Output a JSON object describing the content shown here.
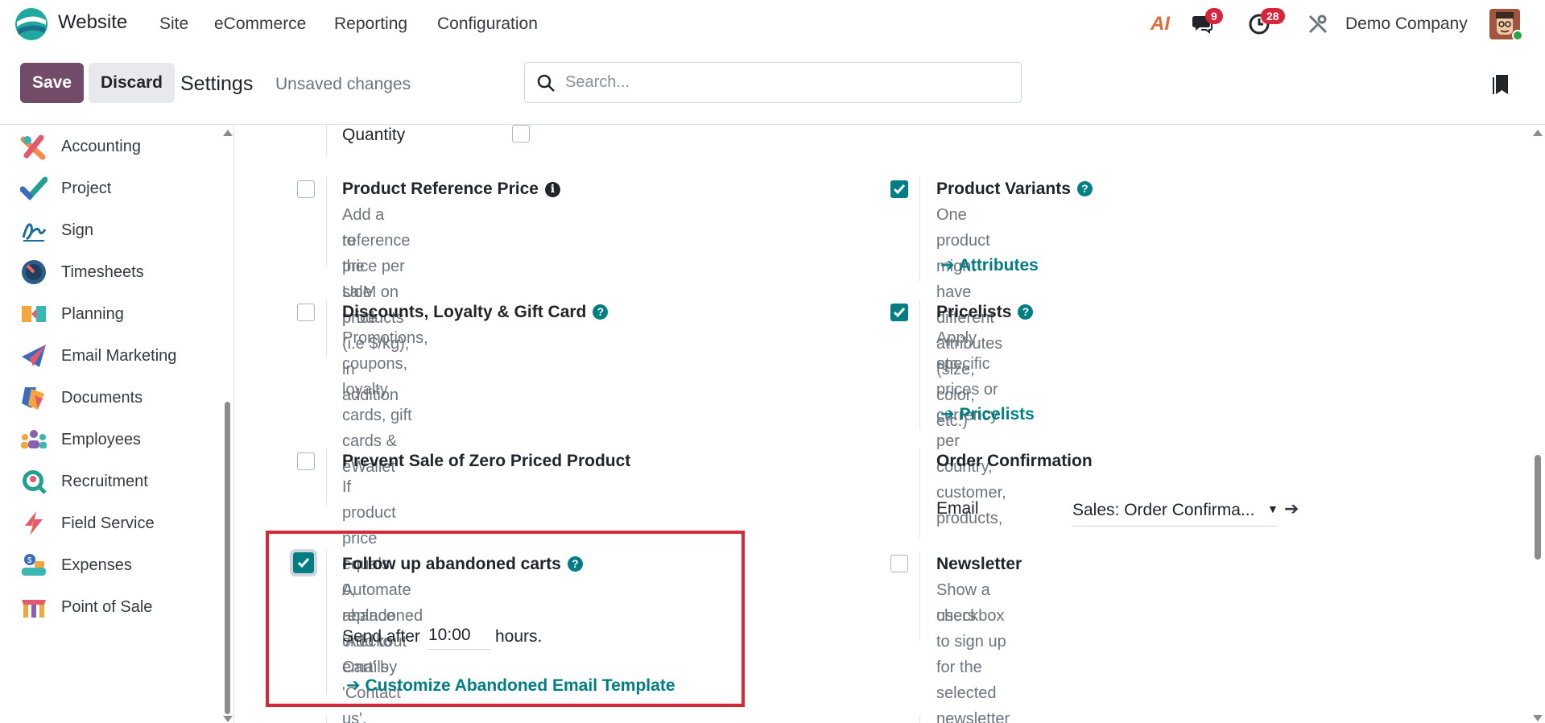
{
  "topnav": {
    "app_title": "Website",
    "menu": [
      "Site",
      "eCommerce",
      "Reporting",
      "Configuration"
    ],
    "messages_count": "9",
    "activities_count": "28",
    "company": "Demo Company",
    "ai_label": "AI"
  },
  "control_panel": {
    "save_label": "Save",
    "discard_label": "Discard",
    "title": "Settings",
    "status": "Unsaved changes",
    "search_placeholder": "Search..."
  },
  "sidebar": {
    "items": [
      {
        "label": "Accounting",
        "icon": "accounting-icon"
      },
      {
        "label": "Project",
        "icon": "project-icon"
      },
      {
        "label": "Sign",
        "icon": "sign-icon"
      },
      {
        "label": "Timesheets",
        "icon": "timesheets-icon"
      },
      {
        "label": "Planning",
        "icon": "planning-icon"
      },
      {
        "label": "Email Marketing",
        "icon": "email-marketing-icon"
      },
      {
        "label": "Documents",
        "icon": "documents-icon"
      },
      {
        "label": "Employees",
        "icon": "employees-icon"
      },
      {
        "label": "Recruitment",
        "icon": "recruitment-icon"
      },
      {
        "label": "Field Service",
        "icon": "field-service-icon"
      },
      {
        "label": "Expenses",
        "icon": "expenses-icon"
      },
      {
        "label": "Point of Sale",
        "icon": "point-of-sale-icon"
      }
    ]
  },
  "settings": {
    "quantity_label": "Quantity",
    "product_reference_price": {
      "title": "Product Reference Price",
      "desc_line1": "Add a reference price per UoM on products (i.e $/kg), in addition",
      "desc_line2": "to the sale price",
      "checked": false
    },
    "product_variants": {
      "title": "Product Variants",
      "desc": "One product might have different attributes (size, color, etc.)",
      "link": "Attributes",
      "checked": true
    },
    "discounts": {
      "title": "Discounts, Loyalty & Gift Card",
      "desc": "Promotions, coupons, loyalty cards, gift cards & eWallet",
      "checked": false
    },
    "pricelists": {
      "title": "Pricelists",
      "desc_line1": "Apply specific prices or currency per country, customer, products,",
      "desc_line2": "etc.",
      "link": "Pricelists",
      "checked": true
    },
    "prevent_zero": {
      "title": "Prevent Sale of Zero Priced Product",
      "desc": "If product price equals 0, replace 'Add to Cart' by 'Contact us'.",
      "checked": false
    },
    "order_confirmation": {
      "title": "Order Confirmation",
      "email_label": "Email",
      "email_value": "Sales: Order Confirma..."
    },
    "abandoned_carts": {
      "title": "Follow up abandoned carts",
      "desc": "Automate abandoned checkout emails",
      "send_after": "Send after",
      "time_value": "10:00",
      "hours": "hours.",
      "link": "Customize Abandoned Email Template",
      "checked": true
    },
    "newsletter": {
      "title": "Newsletter",
      "desc_line1": "Show a checkbox to sign up for the selected newsletter to guest",
      "desc_line2": "users",
      "checked": false
    }
  },
  "colors": {
    "brand": "#714b67",
    "accent": "#017e84",
    "badge": "#d9253b",
    "highlight": "#d22a36"
  }
}
